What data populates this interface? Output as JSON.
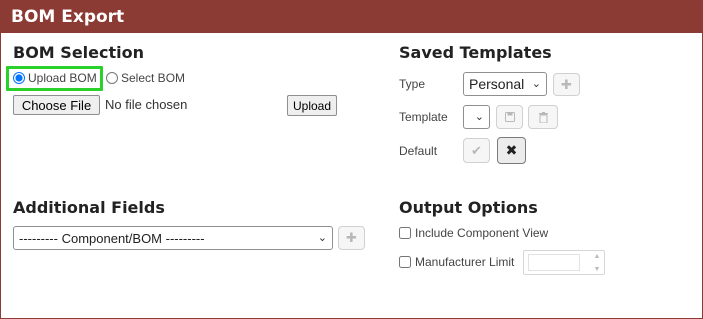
{
  "panel": {
    "title": "BOM Export"
  },
  "bom_selection": {
    "title": "BOM Selection",
    "radio_upload": {
      "label": "Upload BOM",
      "checked": true
    },
    "radio_select": {
      "label": "Select BOM",
      "checked": false
    },
    "choose_file_label": "Choose File",
    "no_file_text": "No file chosen",
    "upload_label": "Upload"
  },
  "saved_templates": {
    "title": "Saved Templates",
    "type_label": "Type",
    "type_value": "Personal",
    "template_label": "Template",
    "template_value": "",
    "default_label": "Default",
    "icons": {
      "add": "plus-icon",
      "save": "save-icon",
      "delete": "trash-icon",
      "set_default": "check-icon",
      "clear_default": "close-icon"
    }
  },
  "additional_fields": {
    "title": "Additional Fields",
    "field_select_value": "--------- Component/BOM ---------"
  },
  "output_options": {
    "title": "Output Options",
    "include_component_view": {
      "label": "Include Component View",
      "checked": false
    },
    "manufacturer_limit": {
      "label": "Manufacturer Limit",
      "checked": false,
      "value": ""
    }
  },
  "colors": {
    "header_bg": "#8c3a34",
    "highlight": "#2bd12b"
  }
}
